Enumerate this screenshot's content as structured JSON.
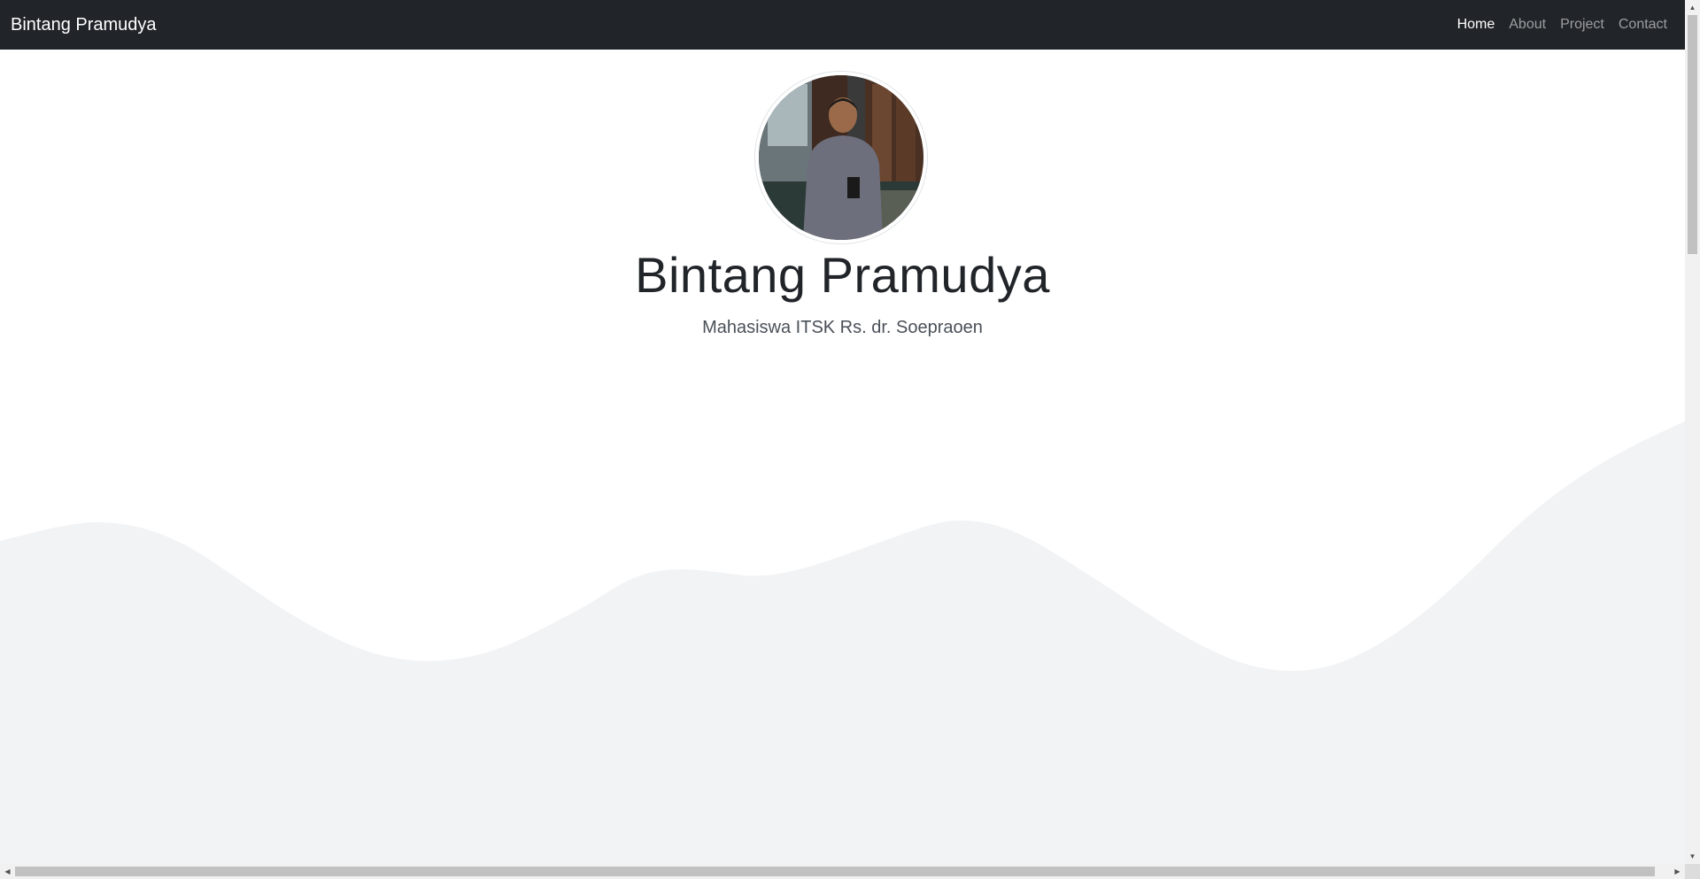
{
  "navbar": {
    "brand": "Bintang Pramudya",
    "links": [
      {
        "label": "Home",
        "active": true
      },
      {
        "label": "About",
        "active": false
      },
      {
        "label": "Project",
        "active": false
      },
      {
        "label": "Contact",
        "active": false
      }
    ]
  },
  "hero": {
    "name": "Bintang Pramudya",
    "subtitle": "Mahasiswa ITSK Rs. dr. Soepraoen",
    "profile_image": "profile-photo"
  },
  "colors": {
    "navbar_bg": "#212529",
    "wave_fill": "#f2f3f5",
    "text_dark": "#212529"
  },
  "icons": {
    "scroll_up": "▲",
    "scroll_down": "▼",
    "scroll_left": "◀",
    "scroll_right": "▶"
  }
}
